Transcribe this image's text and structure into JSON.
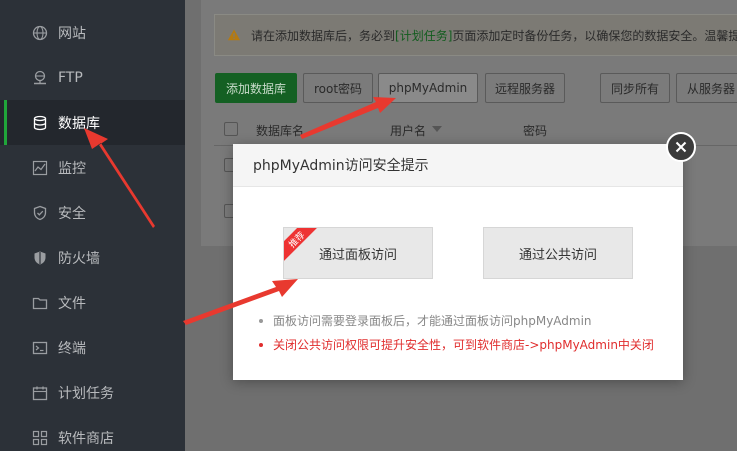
{
  "sidebar": {
    "items": [
      {
        "label": "网站",
        "icon": "globe-icon"
      },
      {
        "label": "FTP",
        "icon": "ftp-icon"
      },
      {
        "label": "数据库",
        "icon": "database-icon",
        "active": true
      },
      {
        "label": "监控",
        "icon": "monitor-icon"
      },
      {
        "label": "安全",
        "icon": "shield-icon"
      },
      {
        "label": "防火墙",
        "icon": "firewall-icon"
      },
      {
        "label": "文件",
        "icon": "folder-icon"
      },
      {
        "label": "终端",
        "icon": "terminal-icon"
      },
      {
        "label": "计划任务",
        "icon": "calendar-icon"
      },
      {
        "label": "软件商店",
        "icon": "grid-icon"
      }
    ]
  },
  "alert": {
    "prefix": "请在添加数据库后，务必到",
    "link": "[计划任务]",
    "suffix": "页面添加定时备份任务，以确保您的数据安全。温馨提"
  },
  "toolbar": {
    "add_db": "添加数据库",
    "root_pwd": "root密码",
    "phpmyadmin": "phpMyAdmin",
    "remote": "远程服务器",
    "sync_all": "同步所有",
    "from_server": "从服务器"
  },
  "table": {
    "columns": [
      "数据库名",
      "用户名",
      "密码"
    ]
  },
  "modal": {
    "title": "phpMyAdmin访问安全提示",
    "panel_access": "通过面板访问",
    "public_access": "通过公共访问",
    "recommend_badge": "推荐",
    "note_grey": "面板访问需要登录面板后，才能通过面板访问phpMyAdmin",
    "note_red": "关闭公共访问权限可提升安全性，可到软件商店->phpMyAdmin中关闭"
  },
  "colors": {
    "accent_green": "#20a53a",
    "annotation_red": "#e8392f"
  }
}
